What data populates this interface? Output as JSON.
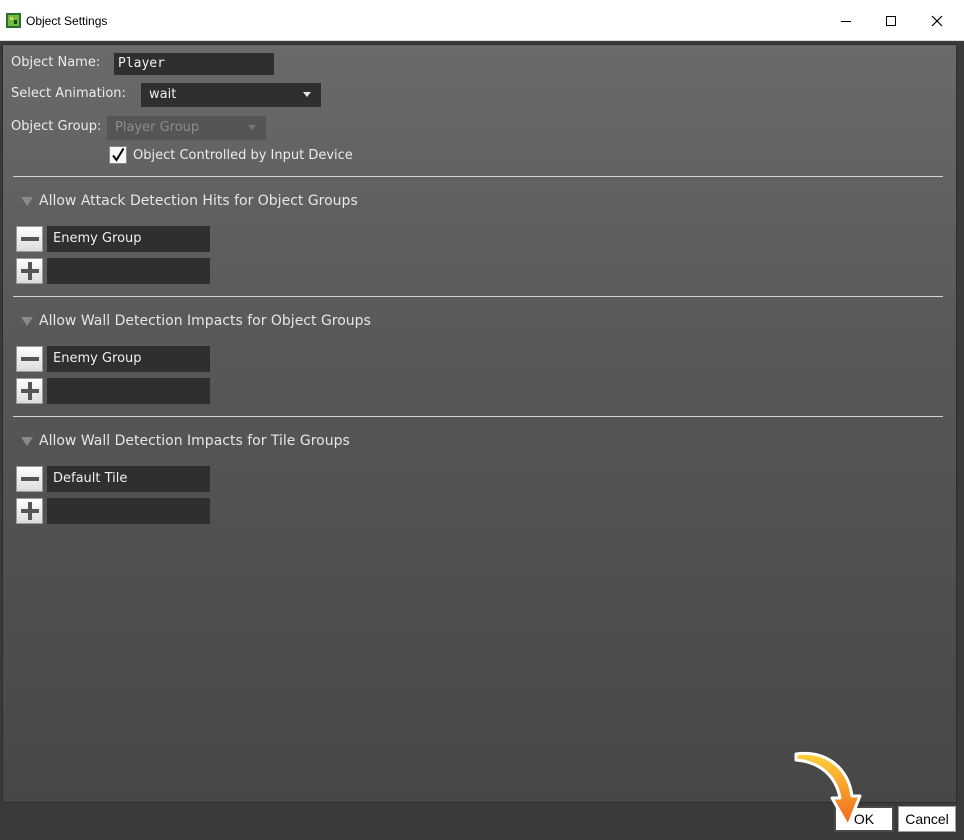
{
  "window": {
    "title": "Object Settings",
    "controls": {
      "minimize": "minimize",
      "maximize": "maximize",
      "close": "close"
    }
  },
  "form": {
    "object_name_label": "Object Name:",
    "object_name_value": "Player",
    "select_animation_label": "Select Animation:",
    "select_animation_value": "wait",
    "object_group_label": "Object Group:",
    "object_group_value": "Player Group",
    "controlled_checkbox_label": "Object Controlled by Input Device",
    "controlled_checked": true
  },
  "sections": [
    {
      "title": "Allow Attack Detection Hits for Object Groups",
      "items": [
        "Enemy Group"
      ]
    },
    {
      "title": "Allow Wall Detection Impacts for Object Groups",
      "items": [
        "Enemy Group"
      ]
    },
    {
      "title": "Allow Wall Detection Impacts for Tile Groups",
      "items": [
        "Default Tile"
      ]
    }
  ],
  "buttons": {
    "ok": "OK",
    "cancel": "Cancel"
  },
  "colors": {
    "accent_arrow": "#f28a1d",
    "panel_top": "#6a6a6a",
    "panel_bottom": "#474747"
  }
}
